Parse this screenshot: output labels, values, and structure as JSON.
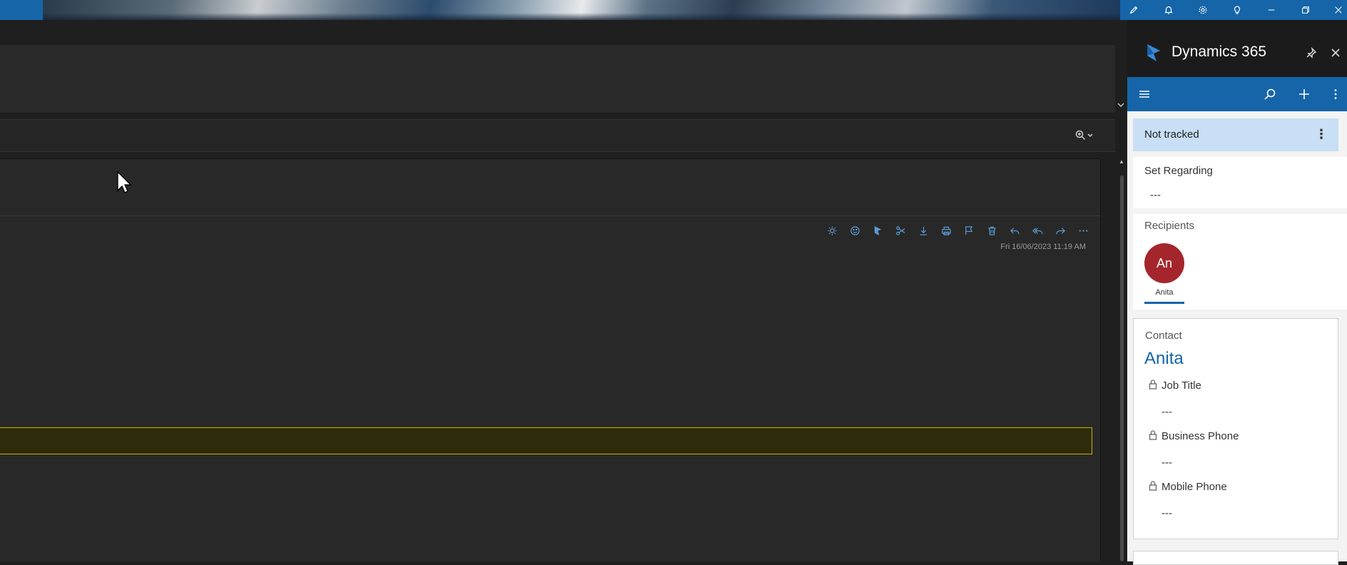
{
  "window": {
    "controls": [
      "edit-icon",
      "bell-icon",
      "gear-icon",
      "lightbulb-icon",
      "minimize-icon",
      "restore-icon",
      "close-icon"
    ]
  },
  "message": {
    "date": "Fri 16/06/2023 11:19 AM",
    "toolbar_icons": [
      "sun-icon",
      "emoji-icon",
      "dynamics-icon",
      "scissors-icon",
      "download-icon",
      "print-icon",
      "flag-icon",
      "delete-icon",
      "reply-icon",
      "reply-all-icon",
      "forward-icon",
      "more-icon"
    ]
  },
  "sidepanel": {
    "title": "Dynamics 365",
    "tracking_status": "Not tracked",
    "set_regarding": {
      "label": "Set Regarding",
      "value": "---"
    },
    "recipients": {
      "label": "Recipients",
      "items": [
        {
          "initials": "An",
          "name": "Anita",
          "color": "#a4262c"
        }
      ]
    },
    "contact": {
      "type_label": "Contact",
      "name": "Anita",
      "fields": [
        {
          "label": "Job Title",
          "value": "---"
        },
        {
          "label": "Business Phone",
          "value": "---"
        },
        {
          "label": "Mobile Phone",
          "value": "---"
        }
      ]
    }
  },
  "colors": {
    "accent": "#1565a8",
    "highlight_border": "#c8b400",
    "avatar": "#a4262c"
  }
}
